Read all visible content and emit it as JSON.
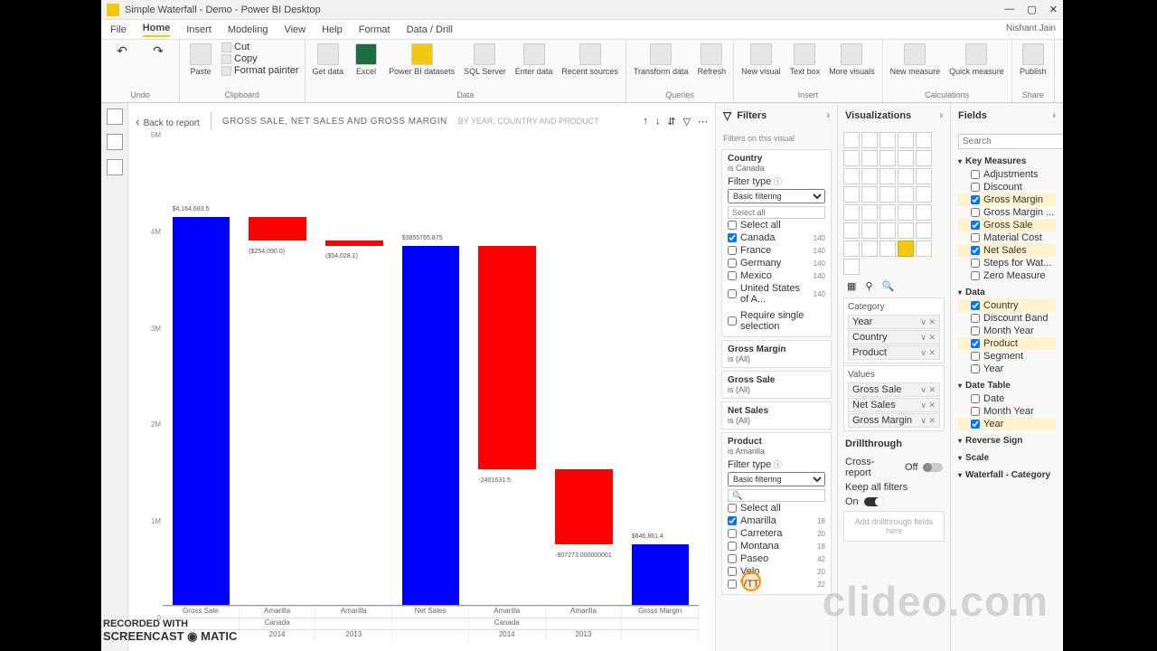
{
  "window": {
    "title": "Simple Waterfall - Demo - Power BI Desktop",
    "user": "Nishant Jain"
  },
  "tabs": {
    "file": "File",
    "home": "Home",
    "insert": "Insert",
    "modeling": "Modeling",
    "view": "View",
    "help": "Help",
    "format": "Format",
    "datadrill": "Data / Drill"
  },
  "ribbon": {
    "undo": "Undo",
    "clipboard": {
      "paste": "Paste",
      "cut": "Cut",
      "copy": "Copy",
      "fp": "Format painter",
      "group": "Clipboard"
    },
    "data": {
      "get": "Get data",
      "excel": "Excel",
      "pbids": "Power BI datasets",
      "sql": "SQL Server",
      "enter": "Enter data",
      "recent": "Recent sources",
      "group": "Data"
    },
    "queries": {
      "transform": "Transform data",
      "refresh": "Refresh",
      "group": "Queries"
    },
    "insert": {
      "newvis": "New visual",
      "textbox": "Text box",
      "more": "More visuals",
      "group": "Insert"
    },
    "calc": {
      "newmeas": "New measure",
      "quick": "Quick measure",
      "group": "Calculations"
    },
    "share": {
      "publish": "Publish",
      "group": "Share"
    }
  },
  "canvas": {
    "back": "Back to report",
    "title": "GROSS SALE, NET SALES AND GROSS MARGIN",
    "subtitle": "BY YEAR, COUNTRY AND PRODUCT"
  },
  "chart_data": {
    "type": "bar",
    "ylabel": "",
    "ylim": [
      0,
      5000000
    ],
    "yticks": [
      "0",
      "1M",
      "2M",
      "3M",
      "4M",
      "5M"
    ],
    "bars": [
      {
        "name": "Gross Sale",
        "start": 0,
        "end": 4164683.5,
        "color": "#0000ff",
        "label": "$4,164,683.5",
        "labelPos": "top"
      },
      {
        "name": "Amarilla-1",
        "start": 4164683.5,
        "end": 3910593.5,
        "color": "#ff0000",
        "label": "($254,090.0)",
        "labelPos": "bottom"
      },
      {
        "name": "Amarilla-2",
        "start": 3910593.5,
        "end": 3855765.875,
        "color": "#ff0000",
        "label": "($54,028.1)",
        "labelPos": "bottom"
      },
      {
        "name": "Net Sales",
        "start": 0,
        "end": 3855765.875,
        "color": "#0000ff",
        "label": "$3855765.875",
        "labelPos": "top"
      },
      {
        "name": "Amarilla-3",
        "start": 3855765.875,
        "end": 1454134,
        "color": "#ff0000",
        "label": "-2401631.5",
        "labelPos": "bottom"
      },
      {
        "name": "Amarilla-4",
        "start": 1454134,
        "end": 646861,
        "color": "#ff0000",
        "label": "-807273.000000001",
        "labelPos": "bottom"
      },
      {
        "name": "Gross Margin",
        "start": 0,
        "end": 646861.4,
        "color": "#0000ff",
        "label": "$646,861.4",
        "labelPos": "top"
      }
    ],
    "x_levels": [
      [
        "Gross Sale",
        "Amarilla",
        "Amarilla",
        "Net Sales",
        "Amarilla",
        "Amarilla",
        "Gross Margin"
      ],
      [
        "",
        "Canada",
        "",
        "",
        "Canada",
        "",
        ""
      ],
      [
        "",
        "2014",
        "2013",
        "",
        "2014",
        "2013",
        ""
      ]
    ]
  },
  "filters": {
    "heading": "Filters",
    "scope": "Filters on this visual",
    "country": {
      "name": "Country",
      "value": "is Canada",
      "typeLabel": "Filter type",
      "type": "Basic filtering",
      "selectall": "Select all",
      "items": [
        {
          "n": "Canada",
          "c": "140",
          "chk": true
        },
        {
          "n": "France",
          "c": "140"
        },
        {
          "n": "Germany",
          "c": "140"
        },
        {
          "n": "Mexico",
          "c": "140"
        },
        {
          "n": "United States of A...",
          "c": "140"
        }
      ],
      "req": "Require single selection"
    },
    "gm": {
      "name": "Gross Margin",
      "value": "is (All)"
    },
    "gs": {
      "name": "Gross Sale",
      "value": "is (All)"
    },
    "ns": {
      "name": "Net Sales",
      "value": "is (All)"
    },
    "product": {
      "name": "Product",
      "value": "is Amarilla",
      "typeLabel": "Filter type",
      "type": "Basic filtering",
      "selectall": "Select all",
      "items": [
        {
          "n": "Amarilla",
          "c": "18",
          "chk": true
        },
        {
          "n": "Carretera",
          "c": "20"
        },
        {
          "n": "Montana",
          "c": "18"
        },
        {
          "n": "Paseo",
          "c": "42"
        },
        {
          "n": "Velo",
          "c": "20"
        },
        {
          "n": "VTT",
          "c": "22"
        }
      ]
    }
  },
  "viz": {
    "heading": "Visualizations",
    "category": "Category",
    "cat_items": [
      "Year",
      "Country",
      "Product"
    ],
    "values": "Values",
    "val_items": [
      "Gross Sale",
      "Net Sales",
      "Gross Margin"
    ],
    "drill": "Drillthrough",
    "cross": "Cross-report",
    "off": "Off",
    "keep": "Keep all filters",
    "on": "On",
    "addhere": "Add drillthrough fields here"
  },
  "fields": {
    "heading": "Fields",
    "search": "Search",
    "tables": [
      {
        "name": "Key Measures",
        "items": [
          {
            "n": "Adjustments"
          },
          {
            "n": "Discount"
          },
          {
            "n": "Gross Margin",
            "chk": true
          },
          {
            "n": "Gross Margin ...",
            "chk": false
          },
          {
            "n": "Gross Sale",
            "chk": true
          },
          {
            "n": "Material Cost"
          },
          {
            "n": "Net Sales",
            "chk": true
          },
          {
            "n": "Steps for Wat..."
          },
          {
            "n": "Zero Measure"
          }
        ]
      },
      {
        "name": "Data",
        "items": [
          {
            "n": "Country",
            "chk": true
          },
          {
            "n": "Discount Band"
          },
          {
            "n": "Month Year"
          },
          {
            "n": "Product",
            "chk": true
          },
          {
            "n": "Segment"
          },
          {
            "n": "Year"
          }
        ]
      },
      {
        "name": "Date Table",
        "items": [
          {
            "n": "Date"
          },
          {
            "n": "Month Year"
          },
          {
            "n": "Year",
            "chk": true
          }
        ]
      },
      {
        "name": "Reverse Sign",
        "items": []
      },
      {
        "name": "Scale",
        "items": []
      },
      {
        "name": "Waterfall - Category",
        "items": []
      }
    ]
  },
  "watermark": {
    "rec": "RECORDED WITH",
    "som": "SCREENCAST ◉ MATIC",
    "clideo": "clideo.com"
  }
}
